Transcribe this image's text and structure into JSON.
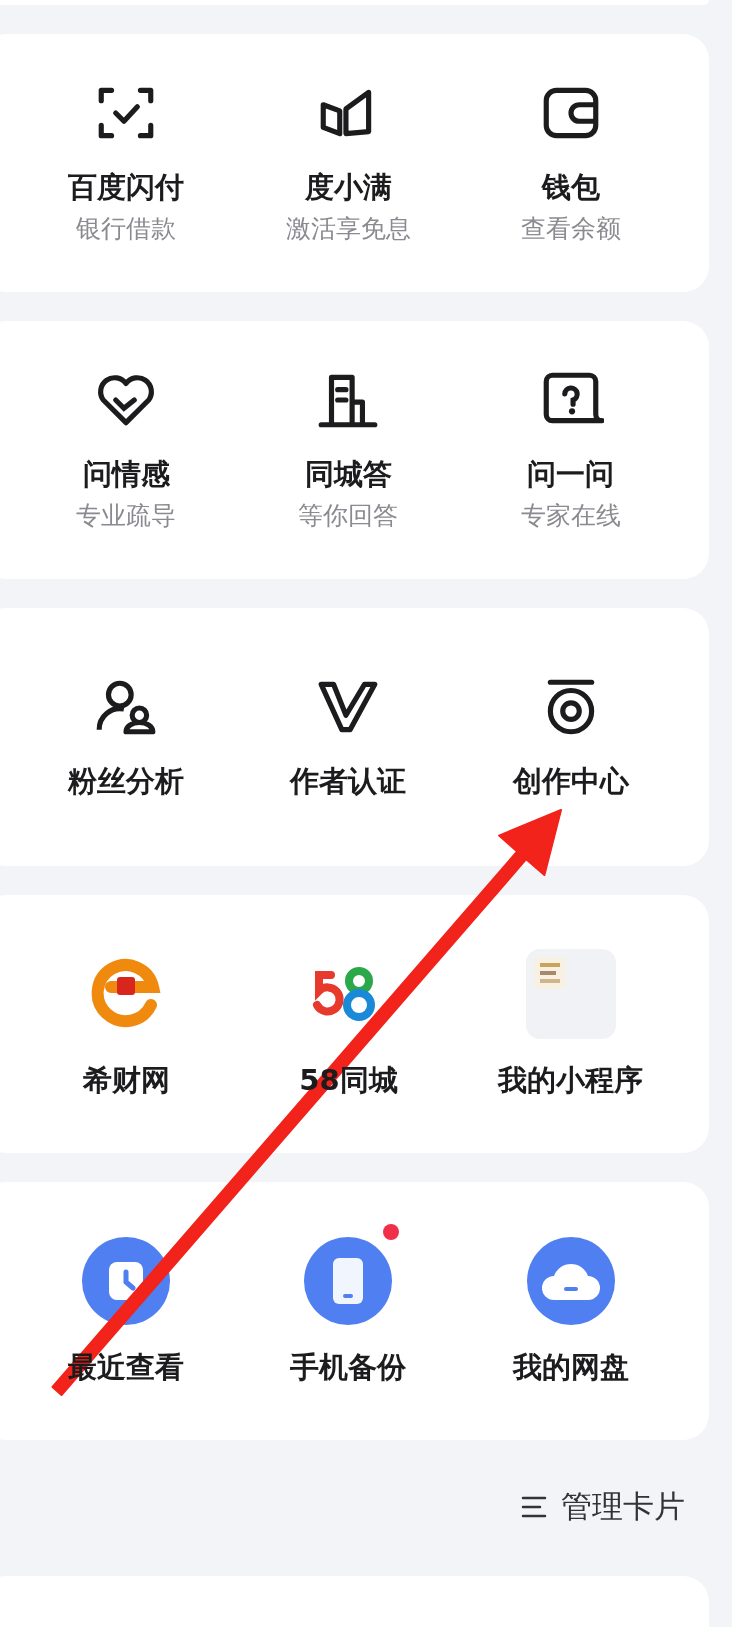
{
  "cards": [
    {
      "items": [
        {
          "title": "百度闪付",
          "subtitle": "银行借款"
        },
        {
          "title": "度小满",
          "subtitle": "激活享免息"
        },
        {
          "title": "钱包",
          "subtitle": "查看余额"
        }
      ]
    },
    {
      "items": [
        {
          "title": "问情感",
          "subtitle": "专业疏导"
        },
        {
          "title": "同城答",
          "subtitle": "等你回答"
        },
        {
          "title": "问一问",
          "subtitle": "专家在线"
        }
      ]
    },
    {
      "items": [
        {
          "title": "粉丝分析"
        },
        {
          "title": "作者认证"
        },
        {
          "title": "创作中心"
        }
      ]
    },
    {
      "items": [
        {
          "title": "希财网"
        },
        {
          "title": "58同城"
        },
        {
          "title": "我的小程序"
        }
      ]
    },
    {
      "items": [
        {
          "title": "最近查看",
          "badge": false
        },
        {
          "title": "手机备份",
          "badge": true
        },
        {
          "title": "我的网盘",
          "badge": false
        }
      ]
    }
  ],
  "manage": {
    "label": "管理卡片"
  },
  "arrow_annotation": true
}
